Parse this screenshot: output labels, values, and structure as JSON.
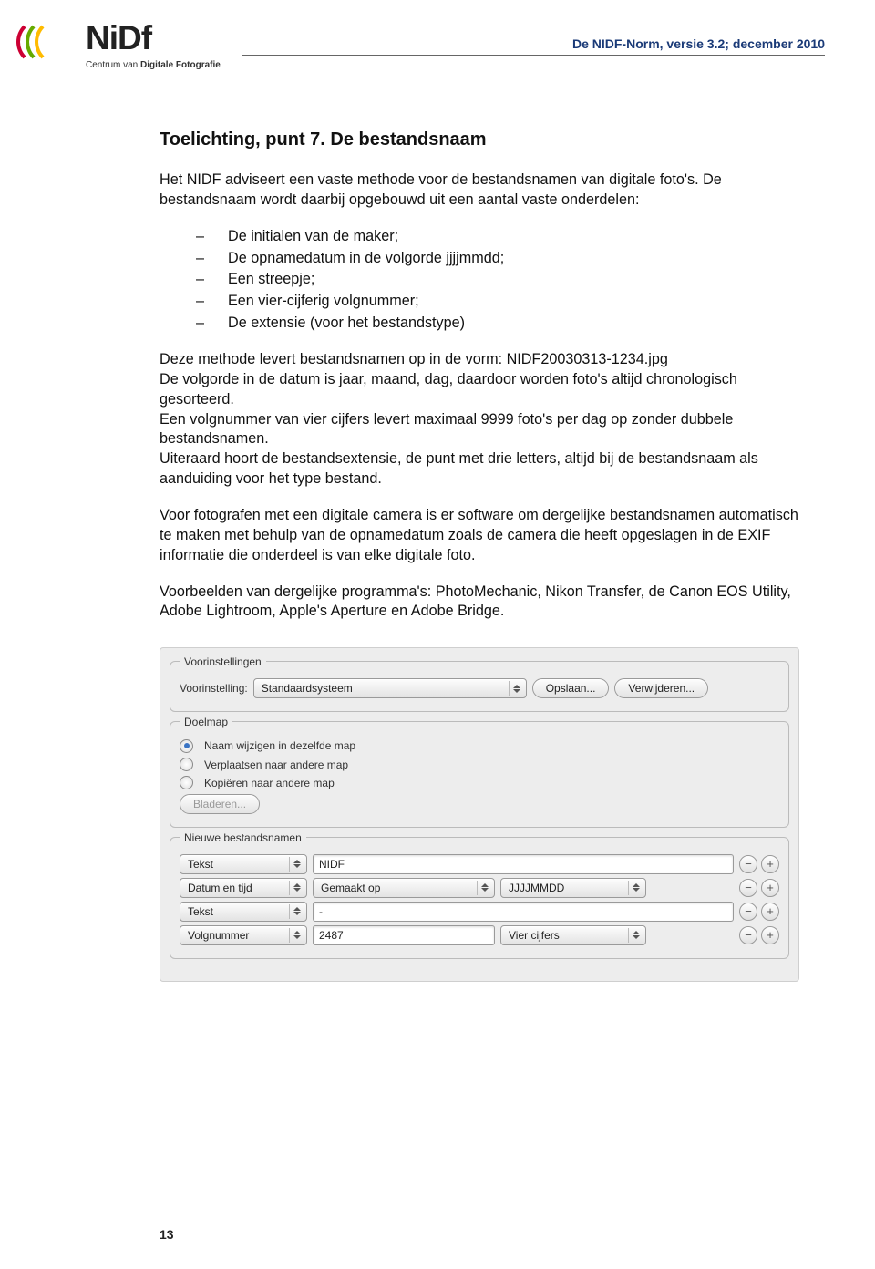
{
  "header": {
    "brand": "NiDf",
    "subtitle_prefix": "Centrum van ",
    "subtitle_bold": "Digitale Fotografie",
    "docline": "De NIDF-Norm, versie 3.2; december 2010"
  },
  "title": "Toelichting, punt 7. De bestandsnaam",
  "intro": "Het NIDF adviseert een vaste methode voor de bestandsnamen van digitale foto's. De bestandsnaam wordt daarbij opgebouwd uit een aantal vaste onderdelen:",
  "bullets": [
    "De initialen van de maker;",
    "De opnamedatum in de volgorde jjjjmmdd;",
    "Een streepje;",
    "Een vier-cijferig volgnummer;",
    "De extensie (voor het bestandstype)"
  ],
  "para2": "Deze methode levert bestandsnamen op in de vorm: NIDF20030313-1234.jpg\nDe volgorde in de datum is jaar, maand, dag, daardoor worden foto's altijd chronologisch gesorteerd.\nEen volgnummer van vier cijfers levert maximaal 9999 foto's per dag op zonder dubbele bestandsnamen.\nUiteraard hoort de bestandsextensie, de punt met drie letters, altijd bij de bestandsnaam als aanduiding voor het type bestand.",
  "para3": "Voor fotografen met een digitale camera is er software om dergelijke bestandsnamen automatisch te maken met behulp van de opnamedatum zoals de camera die heeft opgeslagen in de EXIF informatie die onderdeel is van elke digitale foto.",
  "para4": "Voorbeelden van dergelijke programma's: PhotoMechanic, Nikon Transfer, de Canon EOS Utility, Adobe Lightroom, Apple's Aperture en Adobe Bridge.",
  "ui": {
    "group_presets": "Voorinstellingen",
    "preset_label": "Voorinstelling:",
    "preset_value": "Standaardsysteem",
    "save_btn": "Opslaan...",
    "delete_btn": "Verwijderen...",
    "group_target": "Doelmap",
    "radios": [
      "Naam wijzigen in dezelfde map",
      "Verplaatsen naar andere map",
      "Kopiëren naar andere map"
    ],
    "browse_btn": "Bladeren...",
    "group_newnames": "Nieuwe bestandsnamen",
    "rows": [
      {
        "type": "Tekst",
        "field1": "NIDF",
        "field2": ""
      },
      {
        "type": "Datum en tijd",
        "field1": "Gemaakt op",
        "field2": "JJJJMMDD"
      },
      {
        "type": "Tekst",
        "field1": "-",
        "field2": ""
      },
      {
        "type": "Volgnummer",
        "field1": "2487",
        "field2": "Vier cijfers"
      }
    ]
  },
  "pagenum": "13"
}
